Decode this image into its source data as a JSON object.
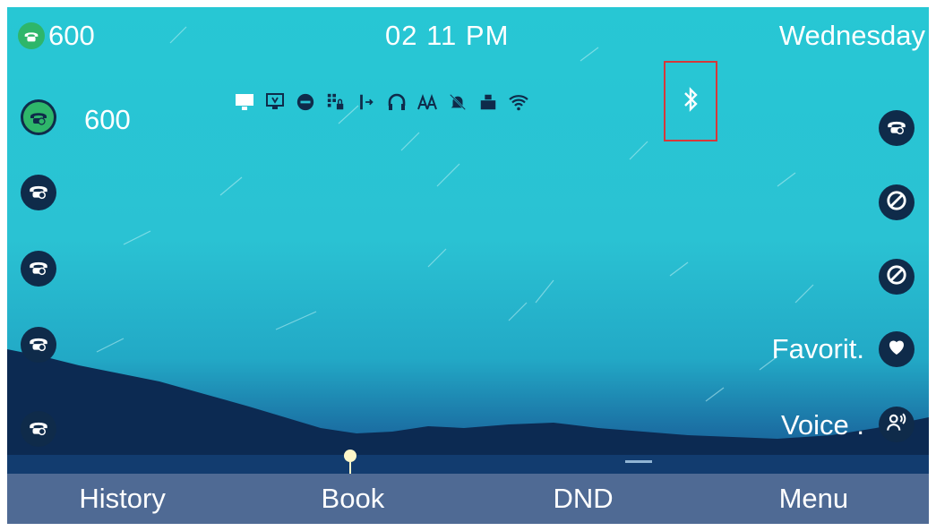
{
  "header": {
    "account": "600",
    "time": "02 11 PM",
    "day": "Wednesday"
  },
  "status_icons": [
    "monitor-icon",
    "tv-monitor-icon",
    "minus-circle-icon",
    "keypad-lock-icon",
    "call-forward-icon",
    "headset-icon",
    "font-icon",
    "mute-bell-icon",
    "usb-icon",
    "wifi-icon",
    "bluetooth-icon"
  ],
  "left_keys": [
    {
      "label": "600",
      "state": "registered"
    },
    {
      "label": "",
      "state": "idle"
    },
    {
      "label": "",
      "state": "idle"
    },
    {
      "label": "",
      "state": "idle"
    },
    {
      "label": "",
      "state": "idle"
    }
  ],
  "right_keys": [
    {
      "label": "",
      "icon": "phone-icon"
    },
    {
      "label": "",
      "icon": "block-icon"
    },
    {
      "label": "",
      "icon": "block-icon"
    },
    {
      "label": "Favorit.",
      "icon": "heart-icon"
    },
    {
      "label": "Voice .",
      "icon": "voice-icon"
    }
  ],
  "softkeys": [
    "History",
    "Book",
    "DND",
    "Menu"
  ],
  "colors": {
    "accent_green": "#2eb66a",
    "key_bg": "#0f2b4a",
    "highlight_border": "#d6383a",
    "softbar": "#4f6a94"
  }
}
